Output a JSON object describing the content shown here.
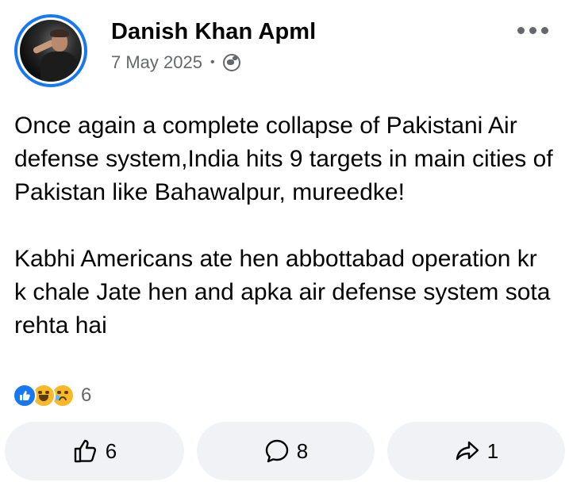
{
  "post": {
    "author": "Danish Khan Apml",
    "date": "7 May 2025",
    "separator": "•",
    "audience_icon": "globe-icon",
    "paragraphs": [
      "Once again a complete collapse of Pakistani Air defense system,India hits 9 targets in main cities of Pakistan like Bahawalpur, mureedke!",
      "Kabhi Americans ate hen abbottabad operation kr k chale Jate hen and apka air defense system sota rehta hai"
    ]
  },
  "reactions": {
    "icons": [
      "like-reaction-icon",
      "haha-reaction-icon",
      "sad-reaction-icon"
    ],
    "count": "6"
  },
  "actions": {
    "like_count": "6",
    "comment_count": "8",
    "share_count": "1"
  },
  "colors": {
    "accent": "#1877f2",
    "secondary_text": "#65676b",
    "button_bg": "#f0f2f5",
    "emoji": "#f7b928"
  }
}
